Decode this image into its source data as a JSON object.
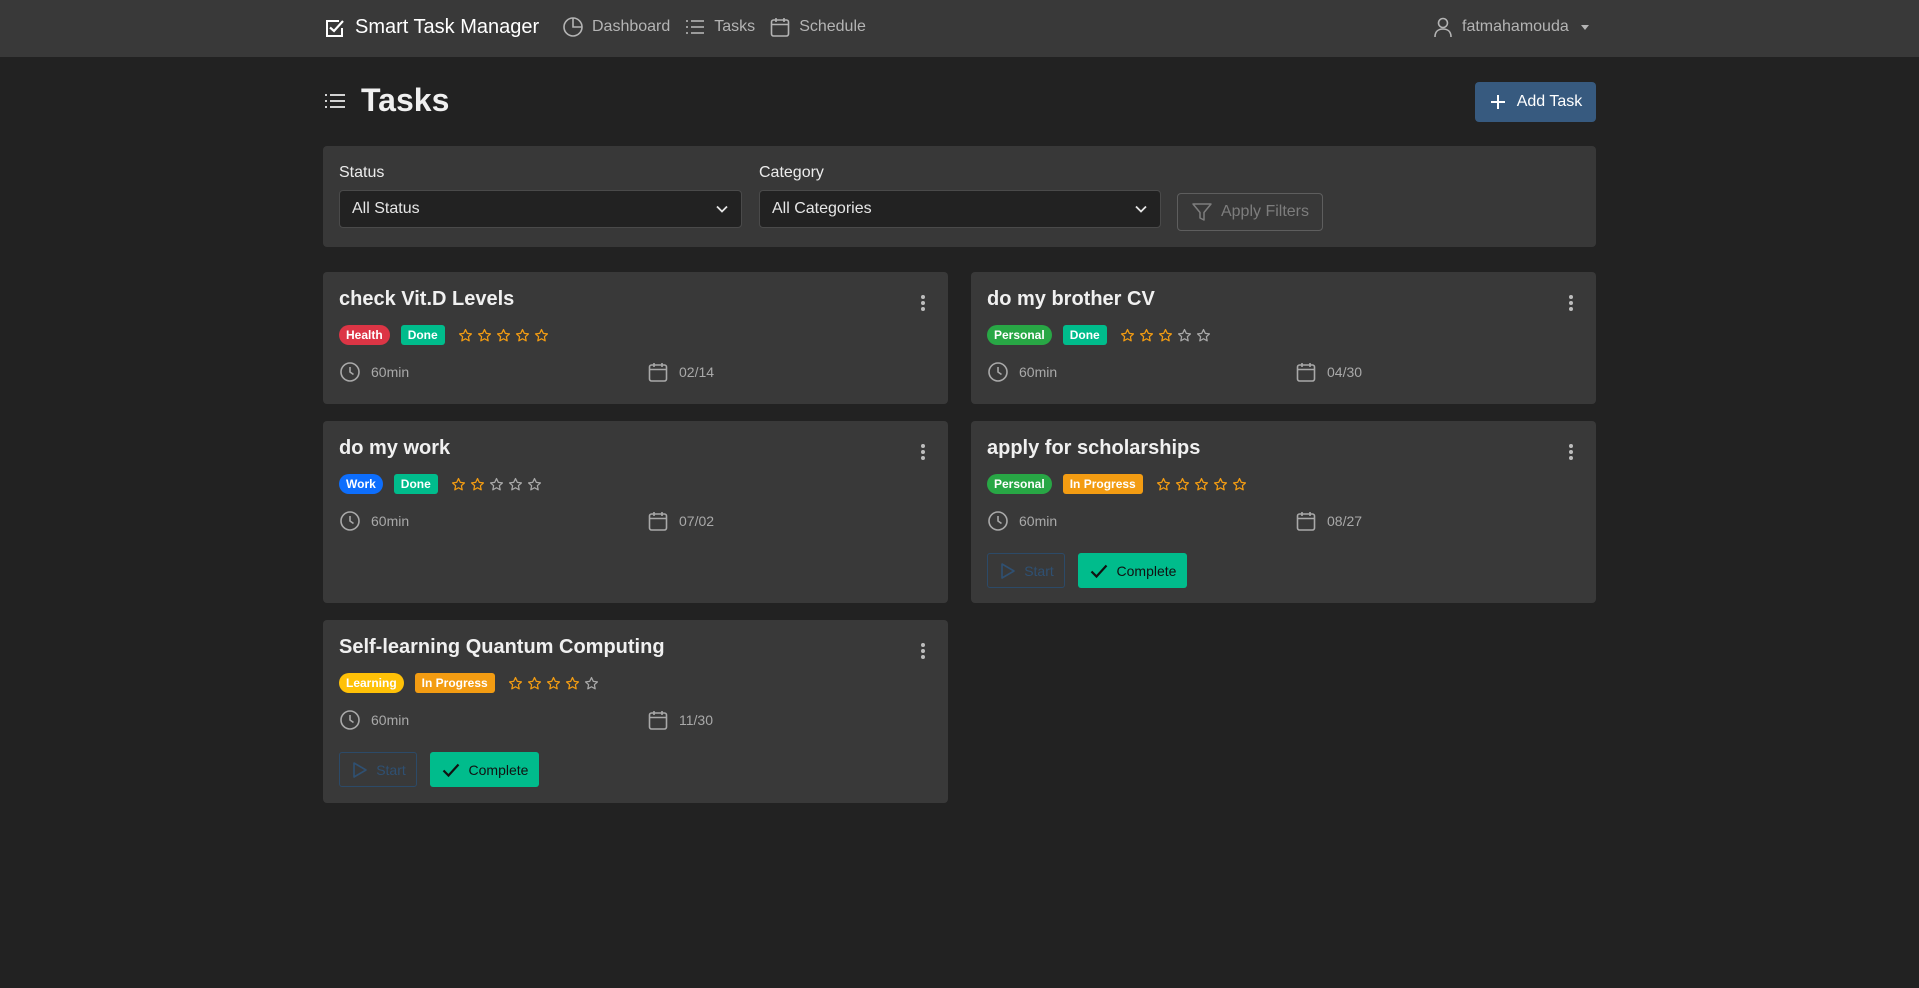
{
  "navbar": {
    "brand": "Smart Task Manager",
    "links": [
      {
        "label": "Dashboard",
        "icon": "pie-chart-icon"
      },
      {
        "label": "Tasks",
        "icon": "list-icon"
      },
      {
        "label": "Schedule",
        "icon": "calendar-icon"
      }
    ],
    "username": "fatmahamouda"
  },
  "page": {
    "title": "Tasks",
    "add_button": "Add Task"
  },
  "filters": {
    "status_label": "Status",
    "status_value": "All Status",
    "category_label": "Category",
    "category_value": "All Categories",
    "apply_button": "Apply Filters"
  },
  "colors": {
    "primary": "#375a7f",
    "success": "#00bc8c",
    "health": "#e74c3c",
    "personal": "#28a745",
    "work": "#0d6efd",
    "learning": "#ffc107",
    "in_progress": "#f39c12",
    "star": "#f39c12"
  },
  "tasks": [
    {
      "title": "check Vit.D Levels",
      "category": "Health",
      "category_color": "#dc3545",
      "status": "Done",
      "status_color": "#00bc8c",
      "rating": 5,
      "duration": "60min",
      "date": "02/14",
      "start_label": "",
      "complete_label": ""
    },
    {
      "title": "do my brother CV",
      "category": "Personal",
      "category_color": "#28a745",
      "status": "Done",
      "status_color": "#00bc8c",
      "rating": 3,
      "duration": "60min",
      "date": "04/30",
      "start_label": "",
      "complete_label": ""
    },
    {
      "title": "do my work",
      "category": "Work",
      "category_color": "#0d6efd",
      "status": "Done",
      "status_color": "#00bc8c",
      "rating": 2,
      "duration": "60min",
      "date": "07/02",
      "start_label": "",
      "complete_label": ""
    },
    {
      "title": "apply for scholarships",
      "category": "Personal",
      "category_color": "#28a745",
      "status": "In Progress",
      "status_color": "#f39c12",
      "rating": 5,
      "duration": "60min",
      "date": "08/27",
      "start_label": "Start",
      "complete_label": "Complete"
    },
    {
      "title": "Self-learning Quantum Computing",
      "category": "Learning",
      "category_color": "#ffc107",
      "status": "In Progress",
      "status_color": "#f39c12",
      "rating": 4,
      "duration": "60min",
      "date": "11/30",
      "start_label": "Start",
      "complete_label": "Complete"
    }
  ]
}
